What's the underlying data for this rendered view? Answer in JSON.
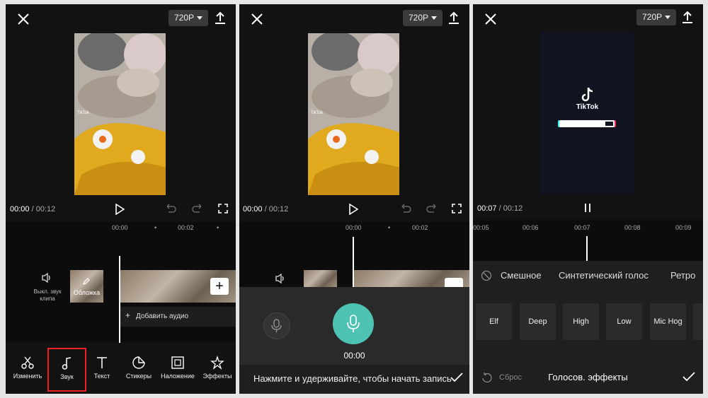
{
  "resolution_label": "720P",
  "panel1": {
    "current_time": "00:00",
    "total_time": "00:12",
    "ruler": [
      "00:00",
      "00:02"
    ],
    "mute_label": "Выкл. звук клипа",
    "cover_label": "Обложка",
    "add_audio_label": "Добавить аудио",
    "toolbar": [
      {
        "label": "Изменить",
        "icon": "scissors-icon"
      },
      {
        "label": "Звук",
        "icon": "music-note-icon"
      },
      {
        "label": "Текст",
        "icon": "text-icon"
      },
      {
        "label": "Стикеры",
        "icon": "sticker-icon"
      },
      {
        "label": "Наложение",
        "icon": "overlay-icon"
      },
      {
        "label": "Эффекты",
        "icon": "effects-icon"
      }
    ],
    "watermark": "TikTok"
  },
  "panel2": {
    "current_time": "00:00",
    "total_time": "00:12",
    "ruler": [
      "00:00",
      "00:02"
    ],
    "record_time": "00:00",
    "hint": "Нажмите и удерживайте, чтобы начать запись"
  },
  "panel3": {
    "current_time": "00:07",
    "total_time": "00:12",
    "ruler": [
      "00:05",
      "00:06",
      "00:07",
      "00:08",
      "00:09"
    ],
    "tiktok_label": "TikTok",
    "categories": [
      "Смешное",
      "Синтетический голос",
      "Ретро"
    ],
    "effects": [
      "Elf",
      "Deep",
      "High",
      "Low",
      "Mic Hog"
    ],
    "reset_label": "Сброс",
    "title": "Голосов. эффекты"
  },
  "colors": {
    "accent": "#4fc3b3",
    "highlight": "#e22222",
    "bg": "#121212"
  }
}
